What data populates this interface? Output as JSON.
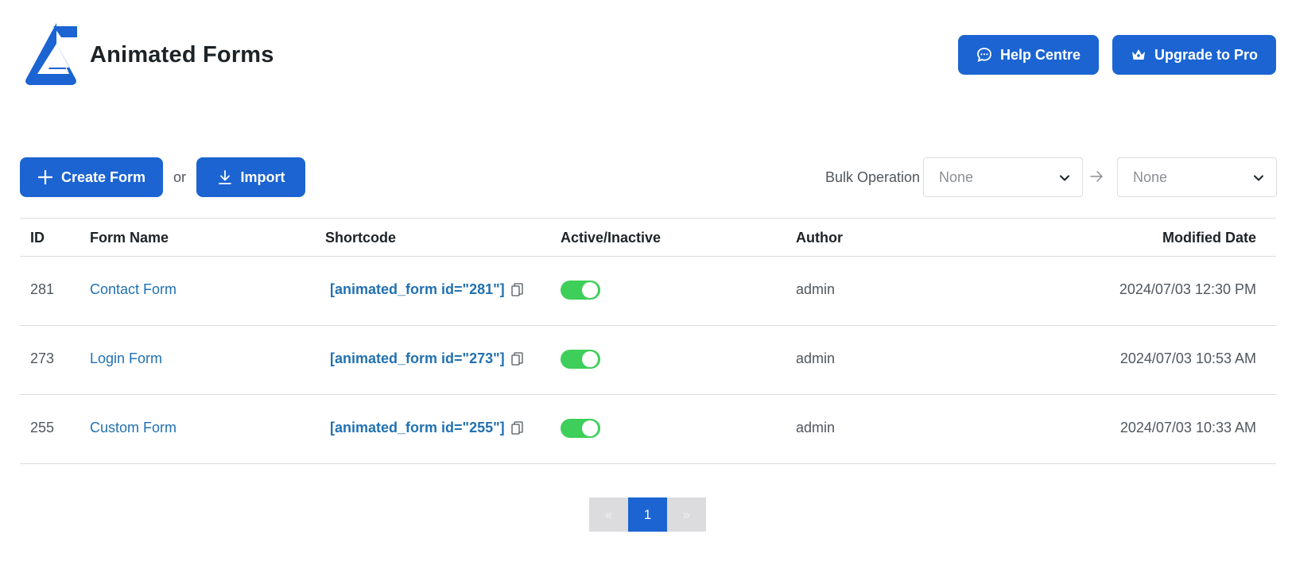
{
  "header": {
    "title": "Animated Forms",
    "help_label": "Help Centre",
    "pro_label": "Upgrade to Pro"
  },
  "toolbar": {
    "create_label": "Create Form",
    "or_text": "or",
    "import_label": "Import",
    "bulk_label": "Bulk Operation",
    "bulk_select_value": "None",
    "bulk_action_value": "None"
  },
  "table": {
    "columns": {
      "id": "ID",
      "name": "Form Name",
      "shortcode": "Shortcode",
      "active": "Active/Inactive",
      "author": "Author",
      "modified": "Modified Date"
    },
    "rows": [
      {
        "id": "281",
        "name": "Contact Form",
        "shortcode": "[animated_form id=\"281\"]",
        "active": true,
        "author": "admin",
        "modified": "2024/07/03 12:30 PM"
      },
      {
        "id": "273",
        "name": "Login Form",
        "shortcode": "[animated_form id=\"273\"]",
        "active": true,
        "author": "admin",
        "modified": "2024/07/03 10:53 AM"
      },
      {
        "id": "255",
        "name": "Custom Form",
        "shortcode": "[animated_form id=\"255\"]",
        "active": true,
        "author": "admin",
        "modified": "2024/07/03 10:33 AM"
      }
    ]
  },
  "pagination": {
    "prev": "«",
    "current": "1",
    "next": "»"
  },
  "colors": {
    "primary": "#1b64d2",
    "link": "#2271b1",
    "toggle_on": "#3ecf5a"
  }
}
